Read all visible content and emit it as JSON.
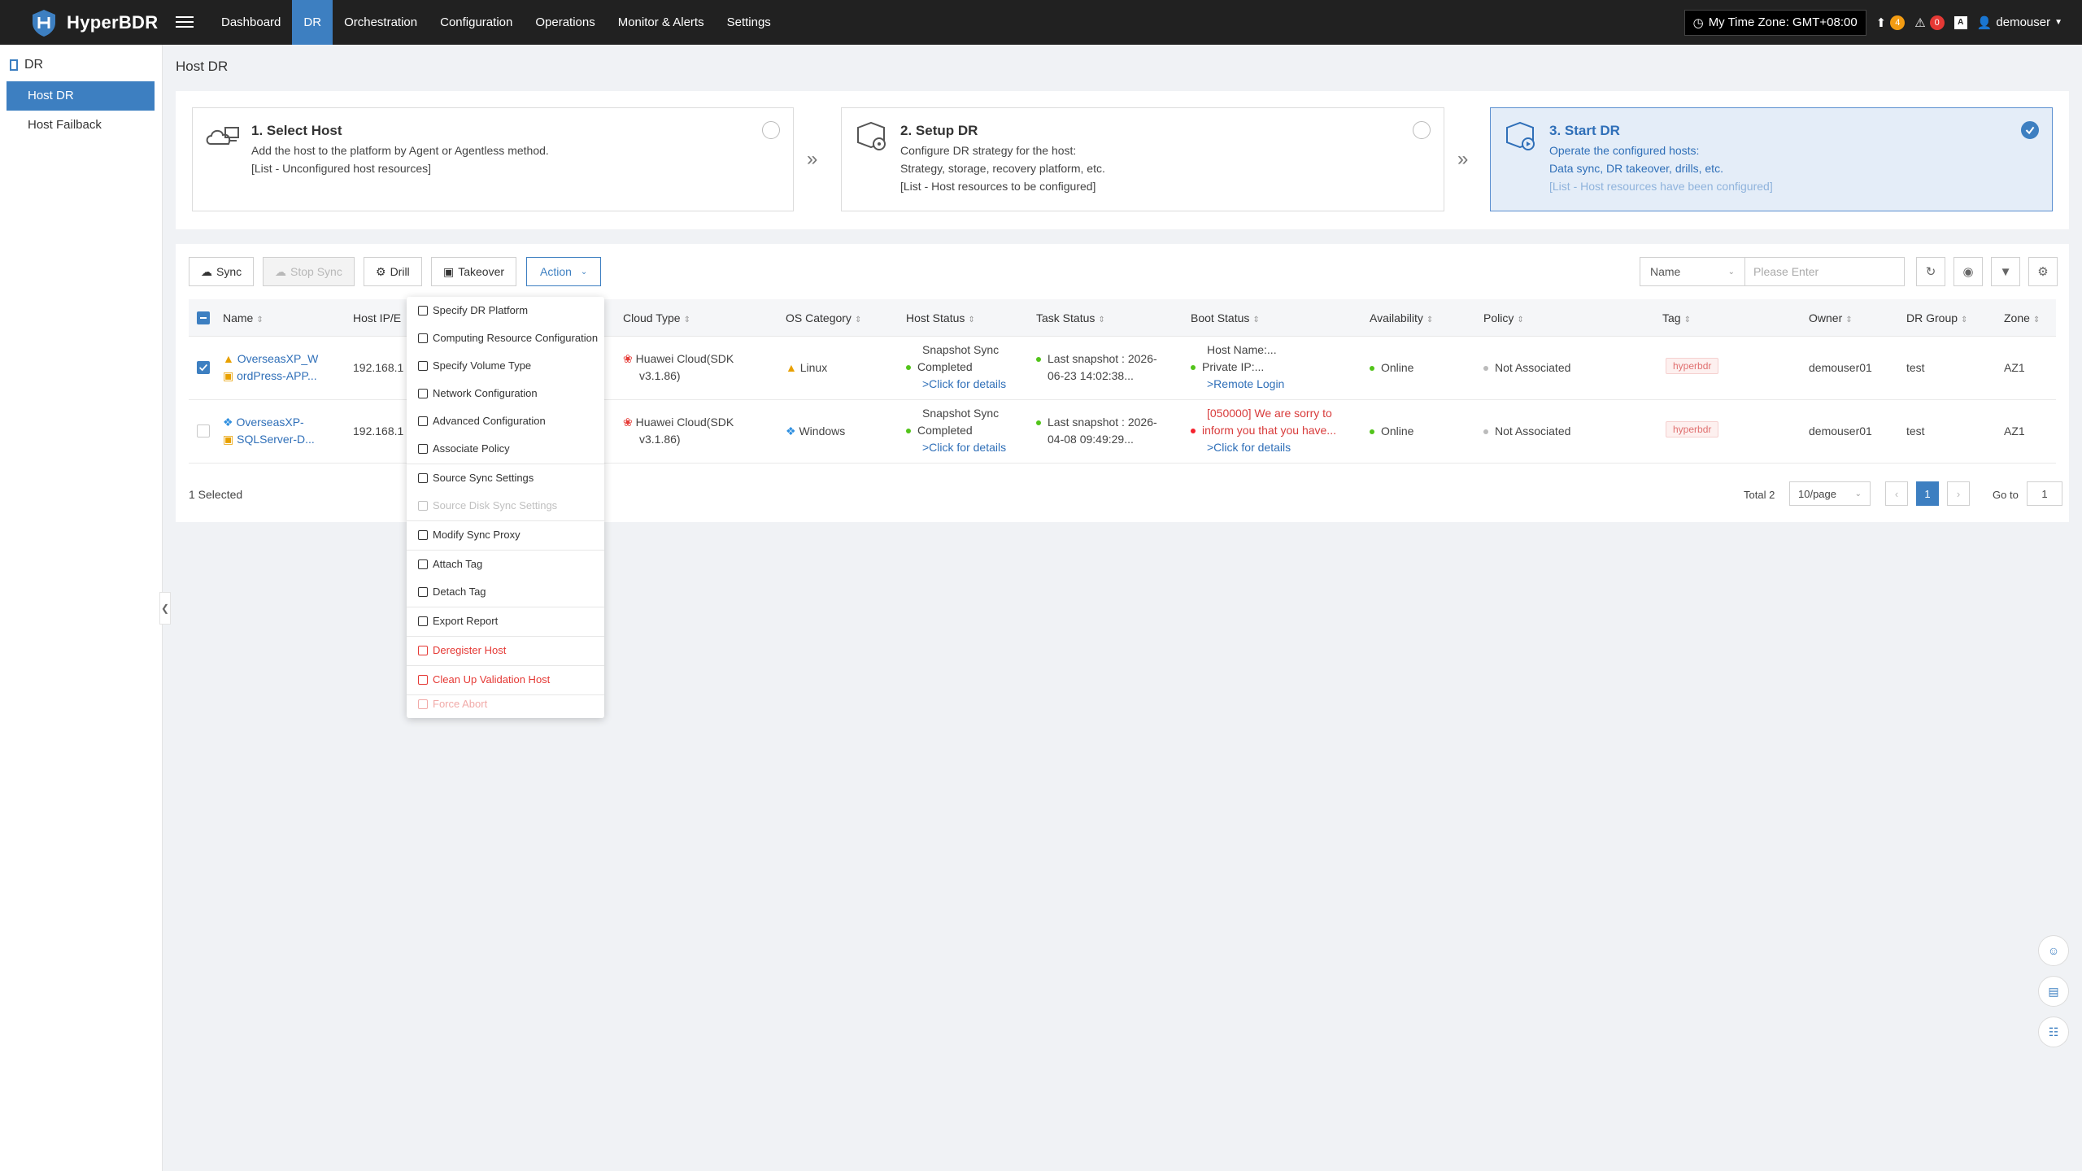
{
  "app": {
    "name": "HyperBDR"
  },
  "nav": [
    "Dashboard",
    "DR",
    "Orchestration",
    "Configuration",
    "Operations",
    "Monitor & Alerts",
    "Settings"
  ],
  "topright": {
    "timezone": "My Time Zone: GMT+08:00",
    "upload_count": "4",
    "alert_count": "0",
    "user": "demouser"
  },
  "sidebar": {
    "title": "DR",
    "items": [
      "Host DR",
      "Host Failback"
    ]
  },
  "page": {
    "title": "Host DR"
  },
  "steps": [
    {
      "title": "1. Select Host",
      "lines": [
        "Add the host to the platform by Agent or Agentless method.",
        "[List - Unconfigured host resources]"
      ]
    },
    {
      "title": "2. Setup DR",
      "lines": [
        "Configure DR strategy for the host:",
        "Strategy, storage, recovery platform, etc.",
        "[List - Host resources to be configured]"
      ]
    },
    {
      "title": "3. Start DR",
      "lines": [
        "Operate the configured hosts:",
        "Data sync, DR takeover, drills, etc.",
        "[List - Host resources have been configured]"
      ]
    }
  ],
  "toolbar": {
    "sync": "Sync",
    "stop_sync": "Stop Sync",
    "drill": "Drill",
    "takeover": "Takeover",
    "action": "Action",
    "filter_field": "Name",
    "search_placeholder": "Please Enter"
  },
  "columns": [
    "Name",
    "Host IP/E",
    "Cloud Type",
    "OS Category",
    "Host Status",
    "Task Status",
    "Boot Status",
    "Availability",
    "Policy",
    "Tag",
    "Owner",
    "DR Group",
    "Zone"
  ],
  "rows": [
    {
      "name1": "OverseasXP_W",
      "name2": "ordPress-APP...",
      "ip": "192.168.1",
      "cloud1": "Huawei Cloud(SDK",
      "cloud2": "v3.1.86)",
      "os": "Linux",
      "hs1": "Snapshot Sync",
      "hs2": "Completed",
      "hs3": ">Click for details",
      "ts1": "Last snapshot : 2026-",
      "ts2": "06-23 14:02:38...",
      "bs1": "Host Name:...",
      "bs2": "Private IP:...",
      "bs3": ">Remote Login",
      "availability": "Online",
      "policy": "Not Associated",
      "tag": "hyperbdr",
      "owner": "demouser01",
      "group": "test",
      "zone": "AZ1"
    },
    {
      "name1": "OverseasXP-",
      "name2": "SQLServer-D...",
      "ip": "192.168.1",
      "cloud1": "Huawei Cloud(SDK",
      "cloud2": "v3.1.86)",
      "os": "Windows",
      "hs1": "Snapshot Sync",
      "hs2": "Completed",
      "hs3": ">Click for details",
      "ts1": "Last snapshot : 2026-",
      "ts2": "04-08 09:49:29...",
      "bs1": "[050000] We are sorry to",
      "bs2": "inform you that you have...",
      "bs3": ">Click for details",
      "availability": "Online",
      "policy": "Not Associated",
      "tag": "hyperbdr",
      "owner": "demouser01",
      "group": "test",
      "zone": "AZ1"
    }
  ],
  "footer": {
    "selected": "1 Selected",
    "total": "Total 2",
    "page_size": "10/page",
    "page": "1",
    "goto_label": "Go to",
    "goto_value": "1"
  },
  "action_menu": [
    "Specify DR Platform",
    "Computing Resource Configuration",
    "Specify Volume Type",
    "Network Configuration",
    "Advanced Configuration",
    "Associate Policy",
    "Source Sync Settings",
    "Source Disk Sync Settings",
    "Modify Sync Proxy",
    "Attach Tag",
    "Detach Tag",
    "Export Report",
    "Deregister Host",
    "Clean Up Validation Host",
    "Force Abort"
  ],
  "colors": {
    "accent": "#3d7fc1",
    "topbar": "#212121",
    "danger": "#e53935",
    "online": "#52c41a"
  }
}
